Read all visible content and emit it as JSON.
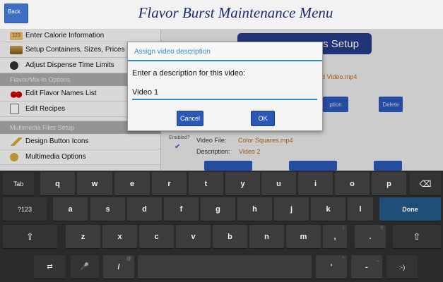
{
  "header": {
    "back_label": "Back",
    "title": "Flavor Burst Maintenance Menu"
  },
  "sidebar": {
    "items": [
      {
        "label": "Enter Calorie Information",
        "icon": "calorie-icon"
      },
      {
        "label": "Setup Containers, Sizes, Prices",
        "icon": "containers-icon"
      },
      {
        "label": "Adjust Dispense Time Limits",
        "icon": "dispense-time-icon"
      }
    ],
    "section1": "Flavor/Mix-In Options",
    "items2": [
      {
        "label": "Edit Flavor Names List",
        "icon": "cherries-icon"
      },
      {
        "label": "Edit Recipes",
        "icon": "recipe-icon"
      }
    ],
    "section2": "Multimedia Files Setup",
    "items3": [
      {
        "label": "Design Button Icons",
        "icon": "brush-icon"
      },
      {
        "label": "Multimedia Options",
        "icon": "multimedia-icon"
      }
    ]
  },
  "main": {
    "setup_title": "eos Setup",
    "video1_file": "d Video.mp4",
    "option_label": "ption",
    "delete_label": "Delete",
    "enabled_label": "Enabled?",
    "video_file_label": "Video File:",
    "video_file_value": "Color Squares.mp4",
    "description_label": "Description:",
    "description_value": "Video 2"
  },
  "dialog": {
    "title": "Assign video description",
    "prompt": "Enter a description for this video:",
    "input_value": "Video 1",
    "cancel_label": "Cancel",
    "ok_label": "OK"
  },
  "keyboard": {
    "row1": [
      "Tab",
      "q",
      "w",
      "e",
      "r",
      "t",
      "y",
      "u",
      "i",
      "o",
      "p",
      "⌫"
    ],
    "row2": [
      "?123",
      "a",
      "s",
      "d",
      "f",
      "g",
      "h",
      "j",
      "k",
      "l",
      "Done"
    ],
    "row3": [
      "⇧",
      "z",
      "x",
      "c",
      "v",
      "b",
      "n",
      "m",
      ",",
      ".",
      "⇧"
    ],
    "row3_sup": [
      "",
      "",
      "",
      "",
      "",
      "",
      "",
      "",
      "!",
      "?",
      ""
    ],
    "row4": [
      "⇄",
      "🎤",
      "/",
      "",
      "'",
      "-",
      ":-)"
    ],
    "row4_sup": [
      "",
      "",
      "@",
      "",
      "\"",
      "_",
      ""
    ]
  },
  "colors": {
    "accent": "#2e8cc8",
    "button_blue": "#2b57b8",
    "title_navy": "#1b2a78",
    "link_orange": "#b5651d"
  }
}
